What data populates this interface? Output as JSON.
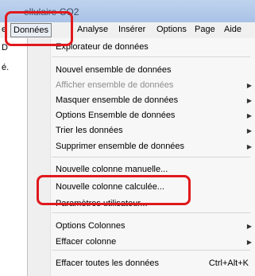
{
  "window": {
    "title": "ellulaire CO2"
  },
  "menubar": {
    "edge_left": "e",
    "items": [
      "Données",
      "Analyse",
      "Insérer",
      "Options",
      "Page",
      "Aide"
    ]
  },
  "left_strip": {
    "row1": "D",
    "row2": "é."
  },
  "menu": {
    "item_explorer": "Explorateur de données",
    "item_new_dataset": "Nouvel ensemble de données",
    "item_show_dataset": "Afficher ensemble de données",
    "item_hide_dataset": "Masquer ensemble de données",
    "item_dataset_options": "Options Ensemble de données",
    "item_sort": "Trier les données",
    "item_delete_dataset": "Supprimer ensemble de données",
    "item_new_manual_column": "Nouvelle colonne manuelle...",
    "item_new_calc_column": "Nouvelle colonne calculée...",
    "item_user_params": "Paramètres utilisateur...",
    "item_column_options": "Options Colonnes",
    "item_clear_column": "Effacer colonne",
    "item_clear_all": "Effacer toutes les données",
    "shortcut_clear_all": "Ctrl+Alt+K"
  },
  "highlight_color": "#e0191d"
}
